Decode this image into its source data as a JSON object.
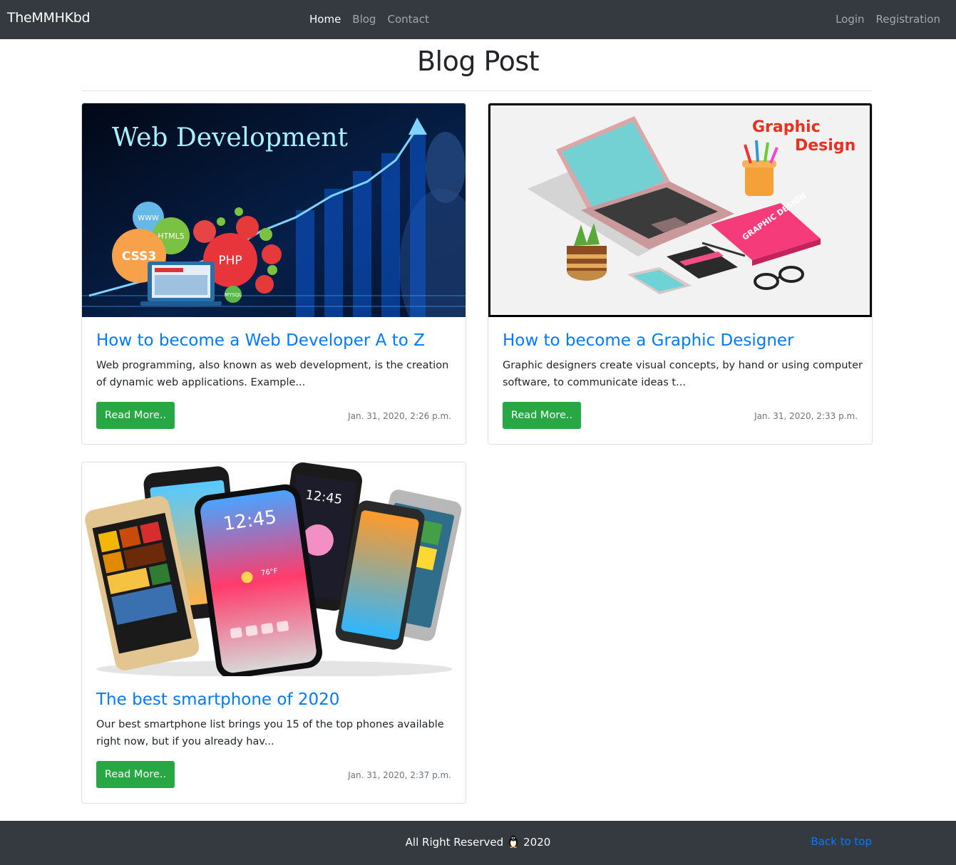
{
  "navbar": {
    "brand": "TheMMHKbd",
    "links": [
      "Home",
      "Blog",
      "Contact"
    ],
    "auth": [
      "Login",
      "Registration"
    ]
  },
  "page": {
    "title": "Blog Post"
  },
  "posts": [
    {
      "title": "How to become a Web Developer A to Z",
      "excerpt": "Web programming, also known as web development, is the creation of dynamic web applications. Example...",
      "button": "Read More..",
      "date": "Jan. 31, 2020, 2:26 p.m.",
      "image": {
        "caption": "Web Development",
        "badges": [
          "WWW",
          "HTML5",
          "CSS3",
          "PHP",
          "MYSQL"
        ]
      }
    },
    {
      "title": "How to become a Graphic Designer",
      "excerpt": "Graphic designers create visual concepts, by hand or using computer software, to communicate ideas t...",
      "button": "Read More..",
      "date": "Jan. 31, 2020, 2:33 p.m.",
      "image": {
        "caption_line1": "Graphic",
        "caption_line2": "Design",
        "book": "GRAPHIC DESIGN"
      }
    },
    {
      "title": "The best smartphone of 2020",
      "excerpt": "Our best smartphone list brings you 15 of the top phones available right now, but if you already hav...",
      "button": "Read More..",
      "date": "Jan. 31, 2020, 2:37 p.m.",
      "image": {
        "clock": "12:45",
        "weather": "76°F"
      }
    }
  ],
  "footer": {
    "text_before": "All Right Reserved",
    "text_after": "2020",
    "back_to_top": "Back to top"
  },
  "colors": {
    "navbar_bg": "#343a40",
    "link": "#007bff",
    "button": "#28a745",
    "muted": "#6c757d"
  }
}
